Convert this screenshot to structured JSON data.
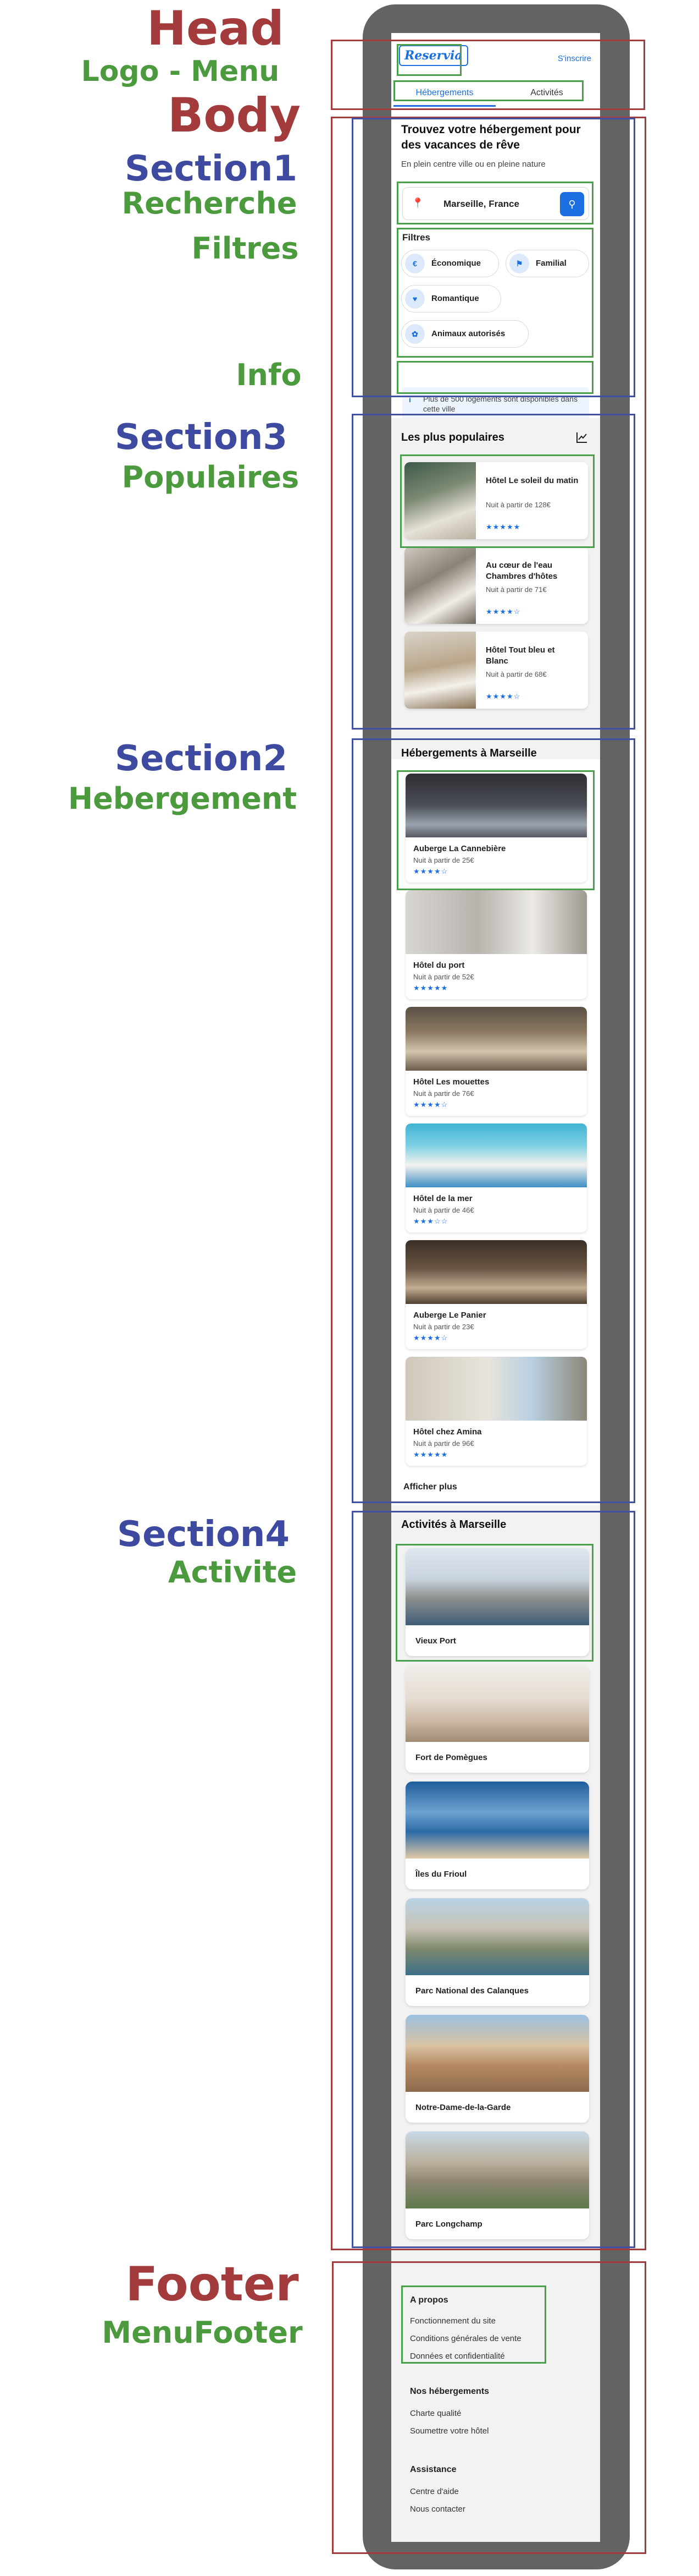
{
  "annotations": {
    "head": "Head",
    "logo_menu": "Logo  - Menu",
    "body": "Body",
    "section1": "Section1",
    "recherche": "Recherche",
    "filtres": "Filtres",
    "info": "Info",
    "section3": "Section3",
    "populaires": "Populaires",
    "section2": "Section2",
    "hebergement": "Hebergement",
    "section4": "Section4",
    "activite": "Activite",
    "footer": "Footer",
    "menufooter": "MenuFooter"
  },
  "colors": {
    "annotation_red": "#a33a3c",
    "annotation_blue": "#3d4aa0",
    "annotation_green": "#4c9a3e",
    "accent": "#1b6fe0",
    "phone_frame": "#636363"
  },
  "header": {
    "logo": "Reservia",
    "signup": "S'inscrire",
    "tabs": [
      {
        "label": "Hébergements",
        "active": true
      },
      {
        "label": "Activités",
        "active": false
      }
    ]
  },
  "search": {
    "title": "Trouvez votre hébergement pour des vacances de rêve",
    "subtitle": "En plein centre ville ou en pleine nature",
    "location": "Marseille, France",
    "location_icon": "map-pin-icon",
    "button_icon": "search-icon"
  },
  "filters": {
    "title": "Filtres",
    "items": [
      {
        "label": "Économique",
        "icon": "money-icon"
      },
      {
        "label": "Familial",
        "icon": "child-icon"
      },
      {
        "label": "Romantique",
        "icon": "heart-icon"
      },
      {
        "label": "Animaux autorisés",
        "icon": "paw-icon"
      }
    ]
  },
  "info": {
    "icon": "info-icon",
    "text": "Plus de 500 logements sont disponibles dans cette ville"
  },
  "popular": {
    "title": "Les plus populaires",
    "icon": "chart-icon",
    "items": [
      {
        "name": "Hôtel Le soleil du matin",
        "price": "Nuit à partir de 128€",
        "stars": "★★★★★"
      },
      {
        "name": "Au cœur de l'eau Chambres d'hôtes",
        "price": "Nuit à partir de 71€",
        "stars": "★★★★☆"
      },
      {
        "name": "Hôtel Tout bleu et Blanc",
        "price": "Nuit à partir de 68€",
        "stars": "★★★★☆"
      }
    ]
  },
  "lodging": {
    "title": "Hébergements à Marseille",
    "more": "Afficher plus",
    "items": [
      {
        "name": "Auberge La Cannebière",
        "price": "Nuit à partir de 25€",
        "stars": "★★★★☆"
      },
      {
        "name": "Hôtel du port",
        "price": "Nuit à partir de 52€",
        "stars": "★★★★★"
      },
      {
        "name": "Hôtel Les mouettes",
        "price": "Nuit à partir de 76€",
        "stars": "★★★★☆"
      },
      {
        "name": "Hôtel de la mer",
        "price": "Nuit à partir de 46€",
        "stars": "★★★☆☆"
      },
      {
        "name": "Auberge Le Panier",
        "price": "Nuit à partir de 23€",
        "stars": "★★★★☆"
      },
      {
        "name": "Hôtel chez Amina",
        "price": "Nuit à partir de 96€",
        "stars": "★★★★★"
      }
    ]
  },
  "activities": {
    "title": "Activités à Marseille",
    "items": [
      {
        "name": "Vieux Port"
      },
      {
        "name": "Fort de Pomègues"
      },
      {
        "name": "Îles du Frioul"
      },
      {
        "name": "Parc National des Calanques"
      },
      {
        "name": "Notre-Dame-de-la-Garde"
      },
      {
        "name": "Parc Longchamp"
      }
    ]
  },
  "footer": {
    "columns": [
      {
        "title": "A propos",
        "links": [
          "Fonctionnement du site",
          "Conditions générales de vente",
          "Données et confidentialité"
        ]
      },
      {
        "title": "Nos hébergements",
        "links": [
          "Charte qualité",
          "Soumettre votre hôtel"
        ]
      },
      {
        "title": "Assistance",
        "links": [
          "Centre d'aide",
          "Nous contacter"
        ]
      }
    ]
  }
}
